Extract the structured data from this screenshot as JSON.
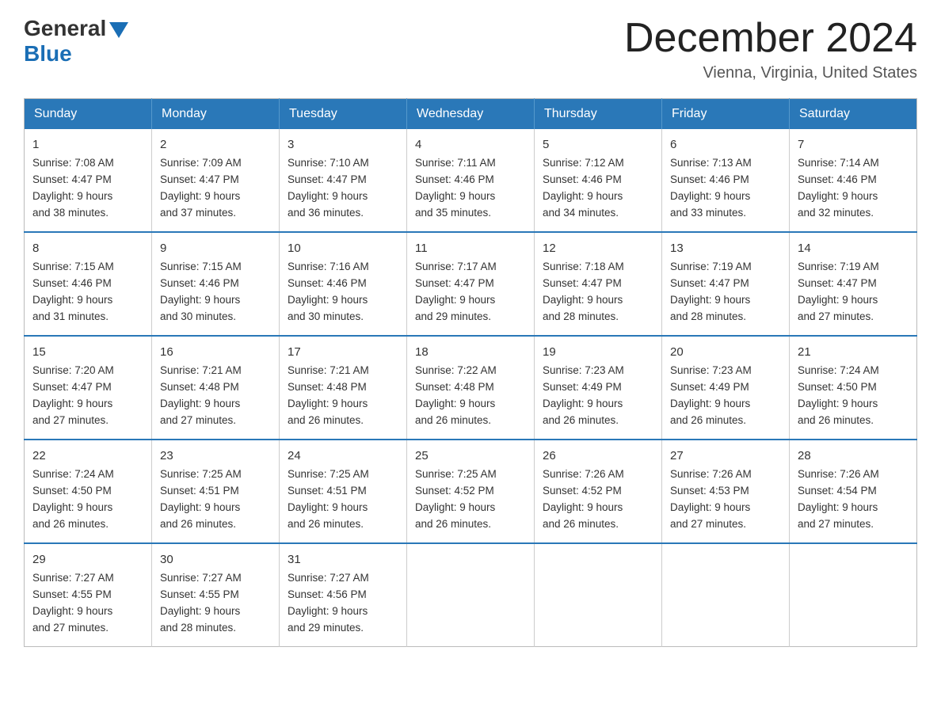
{
  "header": {
    "logo_general": "General",
    "logo_blue": "Blue",
    "title": "December 2024",
    "subtitle": "Vienna, Virginia, United States"
  },
  "weekdays": [
    "Sunday",
    "Monday",
    "Tuesday",
    "Wednesday",
    "Thursday",
    "Friday",
    "Saturday"
  ],
  "weeks": [
    [
      {
        "day": "1",
        "sunrise": "7:08 AM",
        "sunset": "4:47 PM",
        "daylight": "9 hours and 38 minutes."
      },
      {
        "day": "2",
        "sunrise": "7:09 AM",
        "sunset": "4:47 PM",
        "daylight": "9 hours and 37 minutes."
      },
      {
        "day": "3",
        "sunrise": "7:10 AM",
        "sunset": "4:47 PM",
        "daylight": "9 hours and 36 minutes."
      },
      {
        "day": "4",
        "sunrise": "7:11 AM",
        "sunset": "4:46 PM",
        "daylight": "9 hours and 35 minutes."
      },
      {
        "day": "5",
        "sunrise": "7:12 AM",
        "sunset": "4:46 PM",
        "daylight": "9 hours and 34 minutes."
      },
      {
        "day": "6",
        "sunrise": "7:13 AM",
        "sunset": "4:46 PM",
        "daylight": "9 hours and 33 minutes."
      },
      {
        "day": "7",
        "sunrise": "7:14 AM",
        "sunset": "4:46 PM",
        "daylight": "9 hours and 32 minutes."
      }
    ],
    [
      {
        "day": "8",
        "sunrise": "7:15 AM",
        "sunset": "4:46 PM",
        "daylight": "9 hours and 31 minutes."
      },
      {
        "day": "9",
        "sunrise": "7:15 AM",
        "sunset": "4:46 PM",
        "daylight": "9 hours and 30 minutes."
      },
      {
        "day": "10",
        "sunrise": "7:16 AM",
        "sunset": "4:46 PM",
        "daylight": "9 hours and 30 minutes."
      },
      {
        "day": "11",
        "sunrise": "7:17 AM",
        "sunset": "4:47 PM",
        "daylight": "9 hours and 29 minutes."
      },
      {
        "day": "12",
        "sunrise": "7:18 AM",
        "sunset": "4:47 PM",
        "daylight": "9 hours and 28 minutes."
      },
      {
        "day": "13",
        "sunrise": "7:19 AM",
        "sunset": "4:47 PM",
        "daylight": "9 hours and 28 minutes."
      },
      {
        "day": "14",
        "sunrise": "7:19 AM",
        "sunset": "4:47 PM",
        "daylight": "9 hours and 27 minutes."
      }
    ],
    [
      {
        "day": "15",
        "sunrise": "7:20 AM",
        "sunset": "4:47 PM",
        "daylight": "9 hours and 27 minutes."
      },
      {
        "day": "16",
        "sunrise": "7:21 AM",
        "sunset": "4:48 PM",
        "daylight": "9 hours and 27 minutes."
      },
      {
        "day": "17",
        "sunrise": "7:21 AM",
        "sunset": "4:48 PM",
        "daylight": "9 hours and 26 minutes."
      },
      {
        "day": "18",
        "sunrise": "7:22 AM",
        "sunset": "4:48 PM",
        "daylight": "9 hours and 26 minutes."
      },
      {
        "day": "19",
        "sunrise": "7:23 AM",
        "sunset": "4:49 PM",
        "daylight": "9 hours and 26 minutes."
      },
      {
        "day": "20",
        "sunrise": "7:23 AM",
        "sunset": "4:49 PM",
        "daylight": "9 hours and 26 minutes."
      },
      {
        "day": "21",
        "sunrise": "7:24 AM",
        "sunset": "4:50 PM",
        "daylight": "9 hours and 26 minutes."
      }
    ],
    [
      {
        "day": "22",
        "sunrise": "7:24 AM",
        "sunset": "4:50 PM",
        "daylight": "9 hours and 26 minutes."
      },
      {
        "day": "23",
        "sunrise": "7:25 AM",
        "sunset": "4:51 PM",
        "daylight": "9 hours and 26 minutes."
      },
      {
        "day": "24",
        "sunrise": "7:25 AM",
        "sunset": "4:51 PM",
        "daylight": "9 hours and 26 minutes."
      },
      {
        "day": "25",
        "sunrise": "7:25 AM",
        "sunset": "4:52 PM",
        "daylight": "9 hours and 26 minutes."
      },
      {
        "day": "26",
        "sunrise": "7:26 AM",
        "sunset": "4:52 PM",
        "daylight": "9 hours and 26 minutes."
      },
      {
        "day": "27",
        "sunrise": "7:26 AM",
        "sunset": "4:53 PM",
        "daylight": "9 hours and 27 minutes."
      },
      {
        "day": "28",
        "sunrise": "7:26 AM",
        "sunset": "4:54 PM",
        "daylight": "9 hours and 27 minutes."
      }
    ],
    [
      {
        "day": "29",
        "sunrise": "7:27 AM",
        "sunset": "4:55 PM",
        "daylight": "9 hours and 27 minutes."
      },
      {
        "day": "30",
        "sunrise": "7:27 AM",
        "sunset": "4:55 PM",
        "daylight": "9 hours and 28 minutes."
      },
      {
        "day": "31",
        "sunrise": "7:27 AM",
        "sunset": "4:56 PM",
        "daylight": "9 hours and 29 minutes."
      },
      null,
      null,
      null,
      null
    ]
  ],
  "labels": {
    "sunrise": "Sunrise:",
    "sunset": "Sunset:",
    "daylight": "Daylight:"
  }
}
